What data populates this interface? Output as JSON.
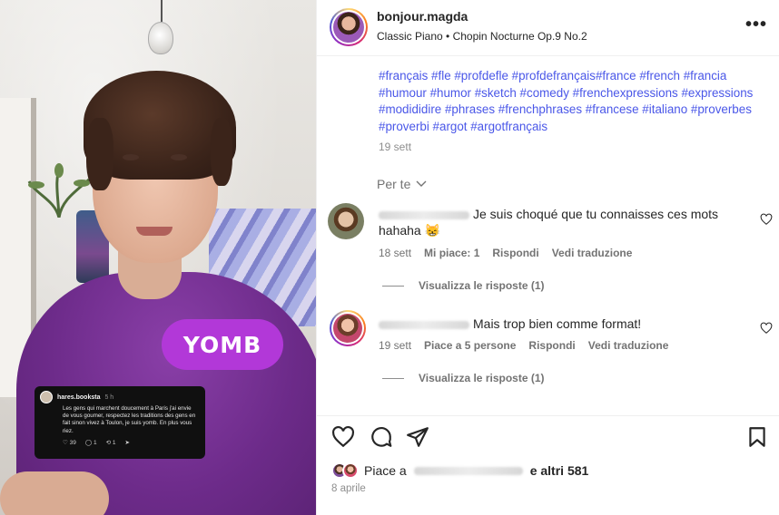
{
  "video": {
    "sticker_text": "YOMB",
    "thread": {
      "username": "hares.booksta",
      "time": "5 h",
      "text": "Les gens qui marchent doucement à Paris j'ai envie de vous goumer, respectez les traditions des gens en fait sinon vivez à Toulon, je suis yomb. En plus vous riez.",
      "likes": "39",
      "comments": "1",
      "reposts": "1"
    }
  },
  "post": {
    "username": "bonjour.magda",
    "audio": "Classic Piano • Chopin Nocturne Op.9 No.2",
    "more_label": "•••",
    "hashtags": "#français #fle #profdefle #profdefrançais#france #french #francia #humour #humor #sketch #comedy #frenchexpressions #expressions #modididire #phrases #frenchphrases #francese #italiano #proverbes #proverbi #argot #argotfrançais",
    "caption_time": "19 sett",
    "filter_label": "Per te",
    "likes_prefix": "Piace a",
    "likes_suffix": "e altri 581",
    "date": "8 aprile"
  },
  "comments": [
    {
      "text": "Je suis choqué que tu connaisses ces mots hahaha 😸",
      "time": "18 sett",
      "likes": "Mi piace: 1",
      "reply": "Rispondi",
      "translate": "Vedi traduzione",
      "view_replies": "Visualizza le risposte (1)"
    },
    {
      "text": "Mais trop bien comme format!",
      "time": "19 sett",
      "likes": "Piace a 5 persone",
      "reply": "Rispondi",
      "translate": "Vedi traduzione",
      "view_replies": "Visualizza le risposte (1)"
    }
  ],
  "icons": {
    "like": "heart-icon",
    "comment": "comment-icon",
    "share": "share-icon",
    "save": "bookmark-icon"
  }
}
